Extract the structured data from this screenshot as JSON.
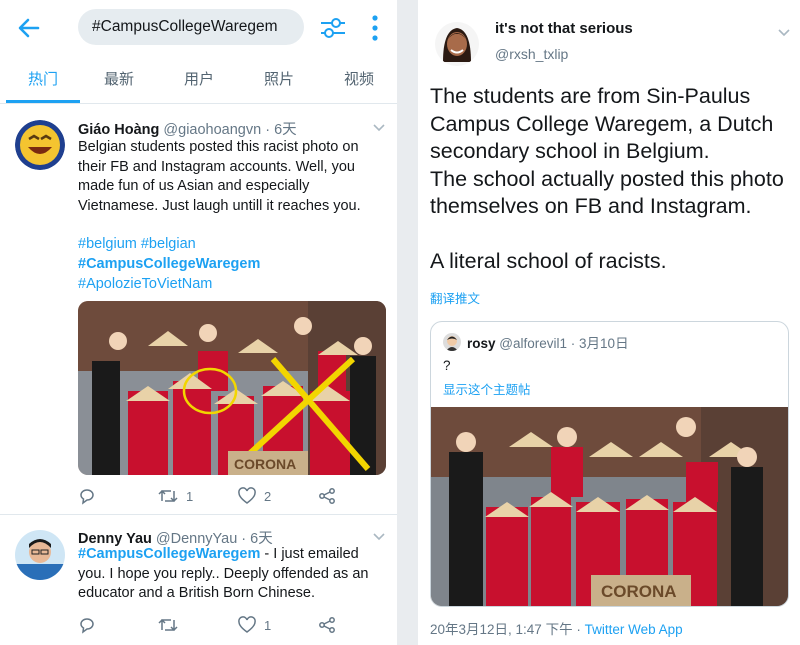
{
  "search": {
    "query": "#CampusCollegeWaregem"
  },
  "tabs": [
    {
      "label": "热门"
    },
    {
      "label": "最新"
    },
    {
      "label": "用户"
    },
    {
      "label": "照片"
    },
    {
      "label": "视频"
    }
  ],
  "icons": {
    "back": "arrow-left-icon",
    "filter": "filter-sliders-icon",
    "more": "more-vertical-icon",
    "reply": "reply-icon",
    "retweet": "retweet-icon",
    "like": "heart-icon",
    "share": "share-icon"
  },
  "colors": {
    "accent": "#1da1f2",
    "secondary": "#657786",
    "border": "#e1e8ed"
  },
  "tweets": [
    {
      "name": "Giáo Hoàng",
      "handle": "@giaohoangvn",
      "time": "· 6天",
      "text": "Belgian students posted this racist photo on their FB and Instagram accounts. Well, you made fun of us Asian and especially Vietnamese. Just laugh untill it reaches you.",
      "hashtags": [
        "#belgium #belgian",
        "#CampusCollegeWaregem",
        "#ApolozieToVietNam"
      ],
      "retweets": "1",
      "likes": "2",
      "photo_sign": "CORONA"
    },
    {
      "name": "Denny Yau",
      "handle": "@DennyYau",
      "time": "· 6天",
      "hashtag": "#CampusCollegeWaregem",
      "text": " - I just emailed you. I hope you reply.. Deeply offended as an educator and a British Born Chinese.",
      "retweets": "",
      "likes": "1"
    }
  ],
  "detail": {
    "name": "it's not that serious",
    "handle": "@rxsh_txlip",
    "lines": [
      "The students are from Sin-Paulus",
      "Campus College Waregem, a Dutch",
      "secondary school in Belgium.",
      "The school actually posted this photo",
      "themselves on FB and Instagram.",
      "",
      "A literal school of racists."
    ],
    "translate": "翻译推文",
    "quote": {
      "name": "rosy",
      "handle": "@alforevil1",
      "time": "· 3月10日",
      "text": "?",
      "show_thread": "显示这个主题帖",
      "photo_sign": "CORONA"
    },
    "footer_time": "20年3月12日, 1:47 下午 · ",
    "footer_app": "Twitter Web App"
  }
}
